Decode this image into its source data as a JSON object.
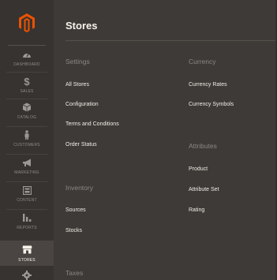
{
  "sidebar": {
    "logo": "magento-logo-icon",
    "items": [
      {
        "label": "DASHBOARD",
        "icon": "dashboard-gauge-icon"
      },
      {
        "label": "SALES",
        "icon": "dollar-icon"
      },
      {
        "label": "CATALOG",
        "icon": "cube-icon"
      },
      {
        "label": "CUSTOMERS",
        "icon": "person-icon"
      },
      {
        "label": "MARKETING",
        "icon": "megaphone-icon"
      },
      {
        "label": "CONTENT",
        "icon": "layout-icon"
      },
      {
        "label": "REPORTS",
        "icon": "bar-chart-icon"
      },
      {
        "label": "STORES",
        "icon": "storefront-icon"
      }
    ],
    "partial_icon": "gear-icon"
  },
  "panel": {
    "title": "Stores",
    "settings": {
      "heading": "Settings",
      "links": [
        "All Stores",
        "Configuration",
        "Terms and Conditions",
        "Order Status"
      ]
    },
    "currency": {
      "heading": "Currency",
      "links": [
        "Currency Rates",
        "Currency Symbols"
      ]
    },
    "attributes": {
      "heading": "Attributes",
      "links": [
        "Product",
        "Attribute Set",
        "Rating"
      ]
    },
    "inventory": {
      "heading": "Inventory",
      "links": [
        "Sources",
        "Stocks"
      ]
    },
    "taxes": {
      "heading": "Taxes"
    }
  },
  "colors": {
    "accent": "#eb5202",
    "panel_bg": "#3e3a37",
    "sidebar_bg": "#373330"
  }
}
